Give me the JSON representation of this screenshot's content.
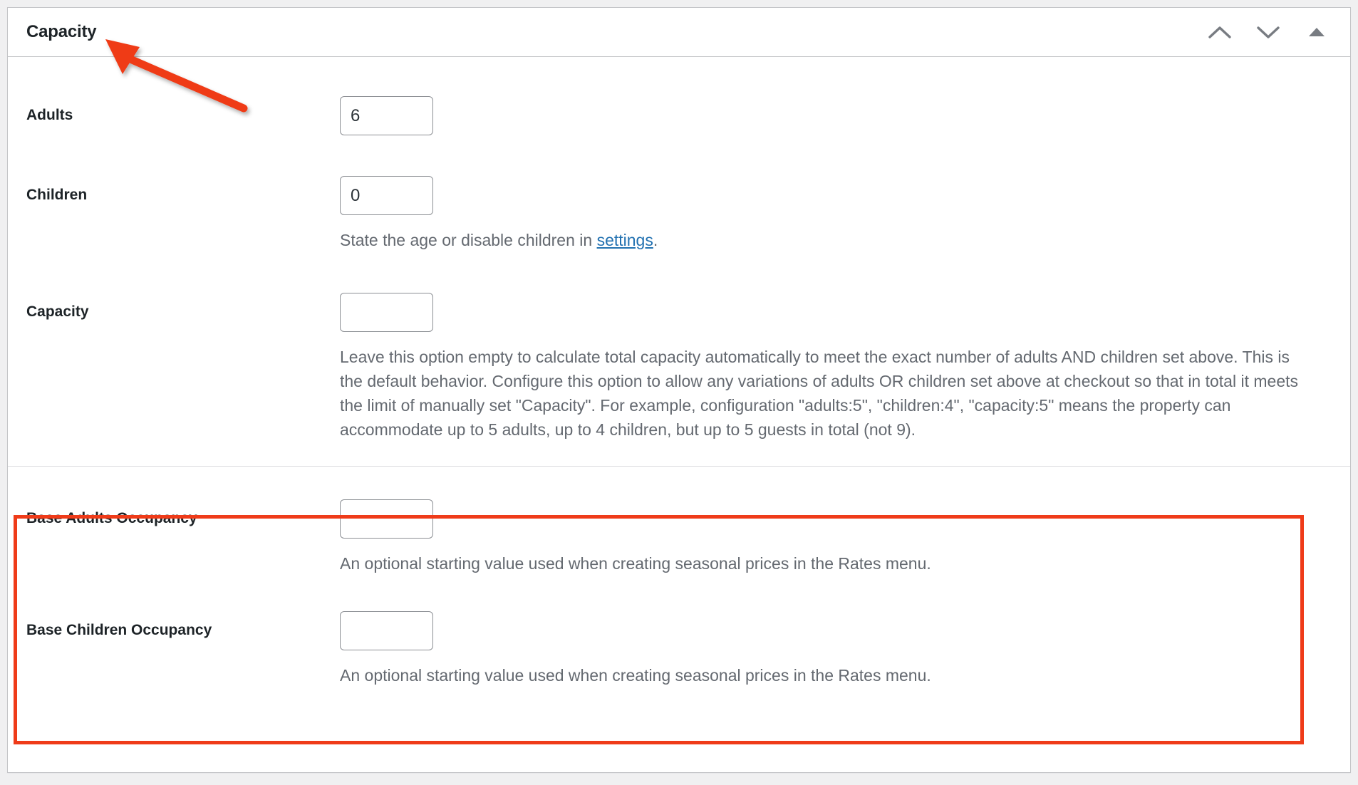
{
  "panel": {
    "title": "Capacity",
    "controls": [
      {
        "name": "move-up",
        "icon": "chevron-up-icon",
        "label": "Move up"
      },
      {
        "name": "move-down",
        "icon": "chevron-down-icon",
        "label": "Move down"
      },
      {
        "name": "toggle-panel",
        "icon": "triangle-up-icon",
        "label": "Toggle panel"
      }
    ]
  },
  "fields": {
    "adults": {
      "label": "Adults",
      "value": "6",
      "placeholder": ""
    },
    "children": {
      "label": "Children",
      "value": "0",
      "placeholder": "",
      "help_before_link": "State the age or disable children in ",
      "help_link": "settings",
      "help_after_link": "."
    },
    "capacity": {
      "label": "Capacity",
      "value": "",
      "placeholder": "",
      "help": "Leave this option empty to calculate total capacity automatically to meet the exact number of adults AND children set above. This is the default behavior. Configure this option to allow any variations of adults OR children set above at checkout so that in total it meets the limit of manually set \"Capacity\". For example, configuration \"adults:5\", \"children:4\", \"capacity:5\" means the property can accommodate up to 5 adults, up to 4 children, but up to 5 guests in total (not 9)."
    },
    "base_adults_occupancy": {
      "label": "Base Adults Occupancy",
      "value": "",
      "placeholder": "",
      "help": "An optional starting value used when creating seasonal prices in the Rates menu."
    },
    "base_children_occupancy": {
      "label": "Base Children Occupancy",
      "value": "",
      "placeholder": "",
      "help": "An optional starting value used when creating seasonal prices in the Rates menu."
    }
  },
  "annotations": {
    "highlight_color": "#ef3b19",
    "arrow_color": "#ef3b19",
    "arrow_points_to": "Capacity",
    "highlight_encloses": "Base Adults Occupancy / Base Children Occupancy"
  },
  "colors": {
    "page_background": "#f0f0f1",
    "panel_background": "#ffffff",
    "panel_border": "#c3c4c7",
    "label_text": "#1d2327",
    "help_text": "#646970",
    "link": "#2271b1",
    "input_border": "#8c8f94",
    "icon": "#787c82"
  }
}
